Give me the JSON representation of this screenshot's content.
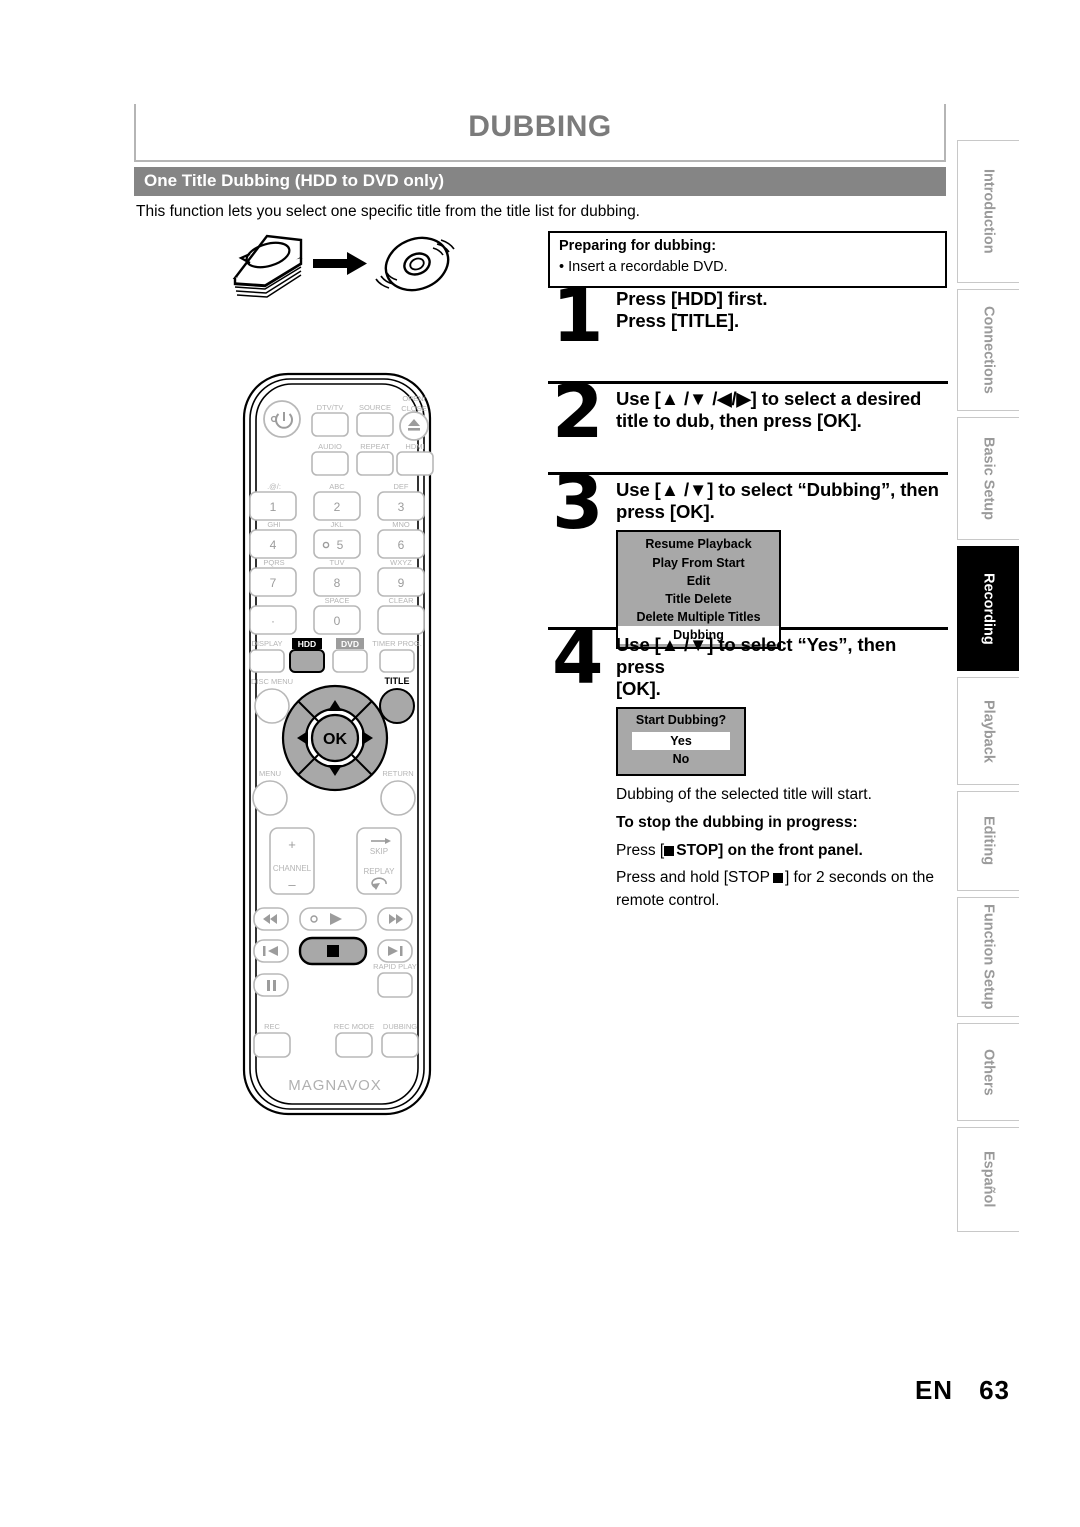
{
  "page": {
    "title": "DUBBING",
    "section_banner": "One Title Dubbing (HDD to DVD only)",
    "intro": "This function lets you select one specific title from the title list for dubbing.",
    "footer_lang": "EN",
    "footer_page": "63"
  },
  "preparing": {
    "heading": "Preparing for dubbing:",
    "bullet": "• Insert a recordable DVD."
  },
  "steps": [
    {
      "num": "1",
      "line1": "Press [HDD] first.",
      "line2": "Press [TITLE]."
    },
    {
      "num": "2",
      "line1": "Use [▲ /▼ /◀/▶] to select a desired",
      "line2": "title to dub, then press [OK]."
    },
    {
      "num": "3",
      "line1": "Use [▲ /▼] to select “Dubbing”, then",
      "line2": "press [OK]."
    },
    {
      "num": "4",
      "line1": "Use [▲ /▼] to select “Yes”, then press",
      "line2": "[OK]."
    }
  ],
  "osd_menu": {
    "items": [
      "Resume Playback",
      "Play From Start",
      "Edit",
      "Title Delete",
      "Delete Multiple Titles"
    ],
    "highlighted": "Dubbing"
  },
  "osd_confirm": {
    "heading": "Start Dubbing?",
    "yes": "Yes",
    "no": "No"
  },
  "after_step4": {
    "line1": "Dubbing of the selected title will start.",
    "bold_heading": "To stop the dubbing in progress:",
    "line2_a": "Press [",
    "line2_b": "STOP] on the front panel.",
    "line3_a": "Press and hold [STOP",
    "line3_b": "] for 2 seconds on the",
    "line3_c": "remote control."
  },
  "sidebar": {
    "tabs": [
      {
        "label": "Introduction",
        "active": false
      },
      {
        "label": "Connections",
        "active": false
      },
      {
        "label": "Basic Setup",
        "active": false
      },
      {
        "label": "Recording",
        "active": true
      },
      {
        "label": "Playback",
        "active": false
      },
      {
        "label": "Editing",
        "active": false
      },
      {
        "label": "Function Setup",
        "active": false
      },
      {
        "label": "Others",
        "active": false
      },
      {
        "label": "Español",
        "active": false
      }
    ]
  },
  "remote": {
    "brand": "MAGNAVOX",
    "labels": {
      "standby": "STANDBY/ON",
      "dtv_tv": "DTV/TV",
      "source": "SOURCE",
      "open_close_1": "OPEN/",
      "open_close_2": "CLOSE",
      "audio": "AUDIO",
      "repeat": "REPEAT",
      "hdmi": "HDMI",
      "k1": ".@/:",
      "k2": "ABC",
      "k3": "DEF",
      "k4": "GHI",
      "k5": "JKL",
      "k6": "MNO",
      "k7": "PQRS",
      "k8": "TUV",
      "k9": "WXYZ",
      "space": "SPACE",
      "clear": "CLEAR",
      "display": "DISPLAY",
      "hdd": "HDD",
      "dvd": "DVD",
      "timer_prog": "TIMER PROG.",
      "disc_menu": "DISC MENU",
      "title": "TITLE",
      "ok": "OK",
      "menu": "MENU",
      "return": "RETURN",
      "channel": "CHANNEL",
      "channel_plus": "+",
      "channel_minus": "–",
      "skip": "SKIP",
      "replay": "REPLAY",
      "rapid_play": "RAPID PLAY",
      "rec": "REC",
      "rec_mode": "REC MODE",
      "dubbing": "DUBBING",
      "num1": "1",
      "num2": "2",
      "num3": "3",
      "num4": "4",
      "num5": "5",
      "num6": "6",
      "num7": "7",
      "num8": "8",
      "num9": "9",
      "num0": "0",
      "dot": "·"
    }
  },
  "colors": {
    "banner_gray": "#858585",
    "title_gray": "#7b7b7b",
    "osd_gray": "#a8a8a8",
    "tab_gray": "#9a9a9a",
    "highlight_black": "#000000"
  }
}
